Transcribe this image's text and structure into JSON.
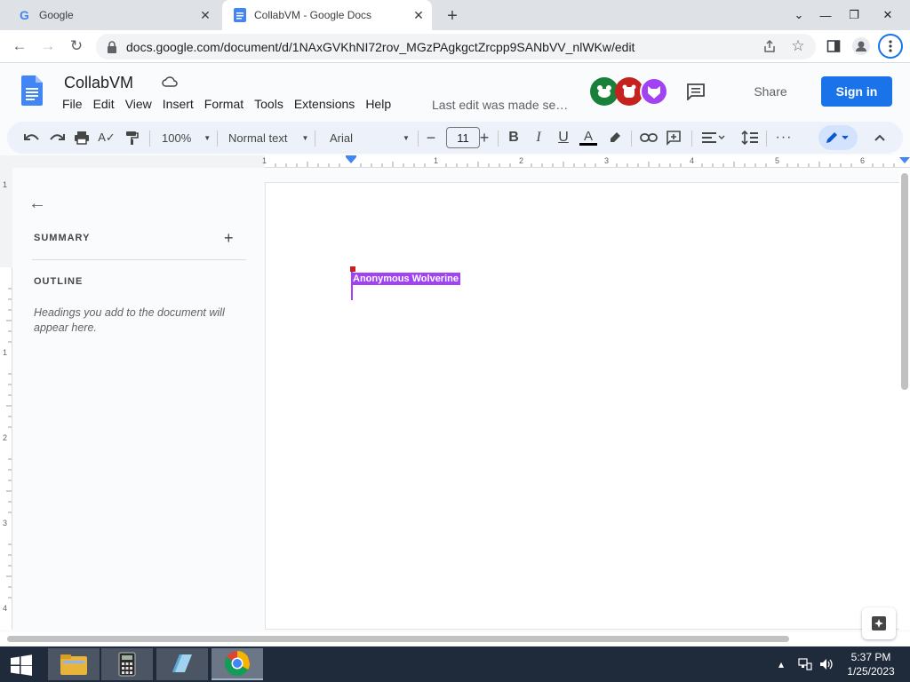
{
  "browser": {
    "tabs": [
      {
        "title": "Google",
        "favicon": "google-g-icon"
      },
      {
        "title": "CollabVM - Google Docs",
        "favicon": "docs-icon"
      }
    ],
    "url": "docs.google.com/document/d/1NAxGVKhNI72rov_MGzPAgkgctZrcpp9SANbVV_nlWKw/edit"
  },
  "docs": {
    "title": "CollabVM",
    "menu": [
      "File",
      "Edit",
      "View",
      "Insert",
      "Format",
      "Tools",
      "Extensions",
      "Help"
    ],
    "last_edit": "Last edit was made se…",
    "share_label": "Share",
    "signin_label": "Sign in",
    "accent_color": "#1a73e8"
  },
  "toolbar": {
    "zoom": "100%",
    "style": "Normal text",
    "font": "Arial",
    "font_size": "11"
  },
  "ruler": {
    "h_ticks": [
      "1",
      "1",
      "2",
      "3",
      "4",
      "5",
      "6"
    ],
    "v_ticks": [
      "1",
      "1",
      "2",
      "3",
      "4"
    ]
  },
  "outline": {
    "summary_label": "SUMMARY",
    "outline_label": "OUTLINE",
    "hint": "Headings you add to the document will appear here."
  },
  "document": {
    "collaborator_name": "Anonymous Wolverine",
    "collaborator_color": "#a142f4"
  },
  "taskbar": {
    "time": "5:37 PM",
    "date": "1/25/2023"
  }
}
